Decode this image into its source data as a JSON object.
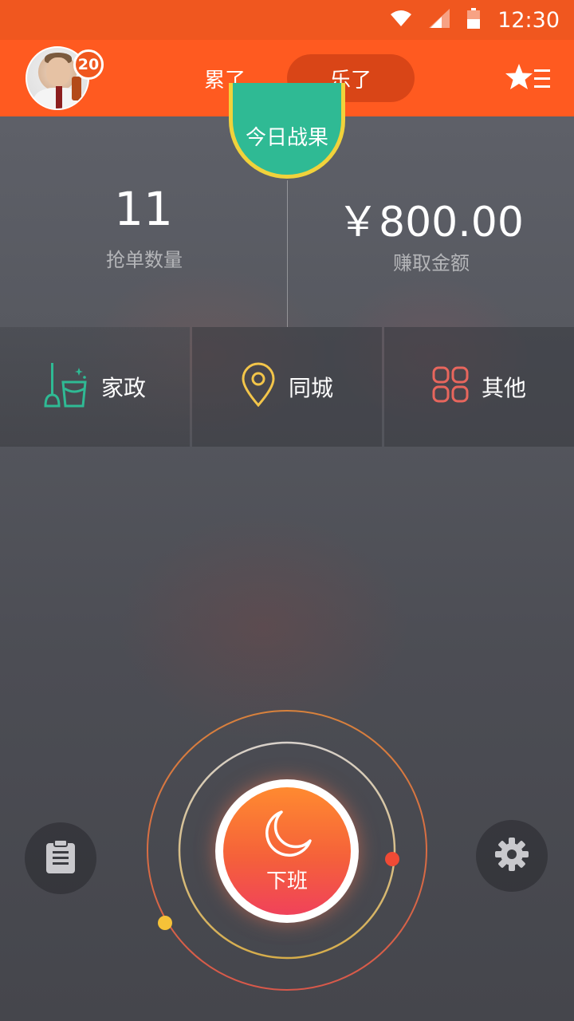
{
  "status_bar": {
    "time": "12:30",
    "icons": [
      "wifi-icon",
      "signal-icon",
      "battery-icon"
    ]
  },
  "header": {
    "badge_count": "20",
    "tabs": [
      {
        "label": "累了",
        "active": false
      },
      {
        "label": "乐了",
        "active": true
      }
    ],
    "menu_icon": "star-menu-icon"
  },
  "stats": {
    "badge_label": "今日战果",
    "orders_value": "11",
    "orders_label": "抢单数量",
    "money_value": "￥800.00",
    "money_label": "赚取金额"
  },
  "categories": [
    {
      "label": "家政",
      "icon": "broom-bucket-icon",
      "color": "#2fba94"
    },
    {
      "label": "同城",
      "icon": "location-pin-icon",
      "color": "#f3c54a"
    },
    {
      "label": "其他",
      "icon": "grid-icon",
      "color": "#e8665d"
    }
  ],
  "controls": {
    "offwork_label": "下班",
    "offwork_icon": "moon-icon",
    "left_icon": "clipboard-icon",
    "right_icon": "gear-icon"
  },
  "colors": {
    "header": "#ff5a20",
    "status_bar": "#f0571f",
    "badge_green": "#2fba94",
    "badge_ring": "#f1d23b"
  }
}
